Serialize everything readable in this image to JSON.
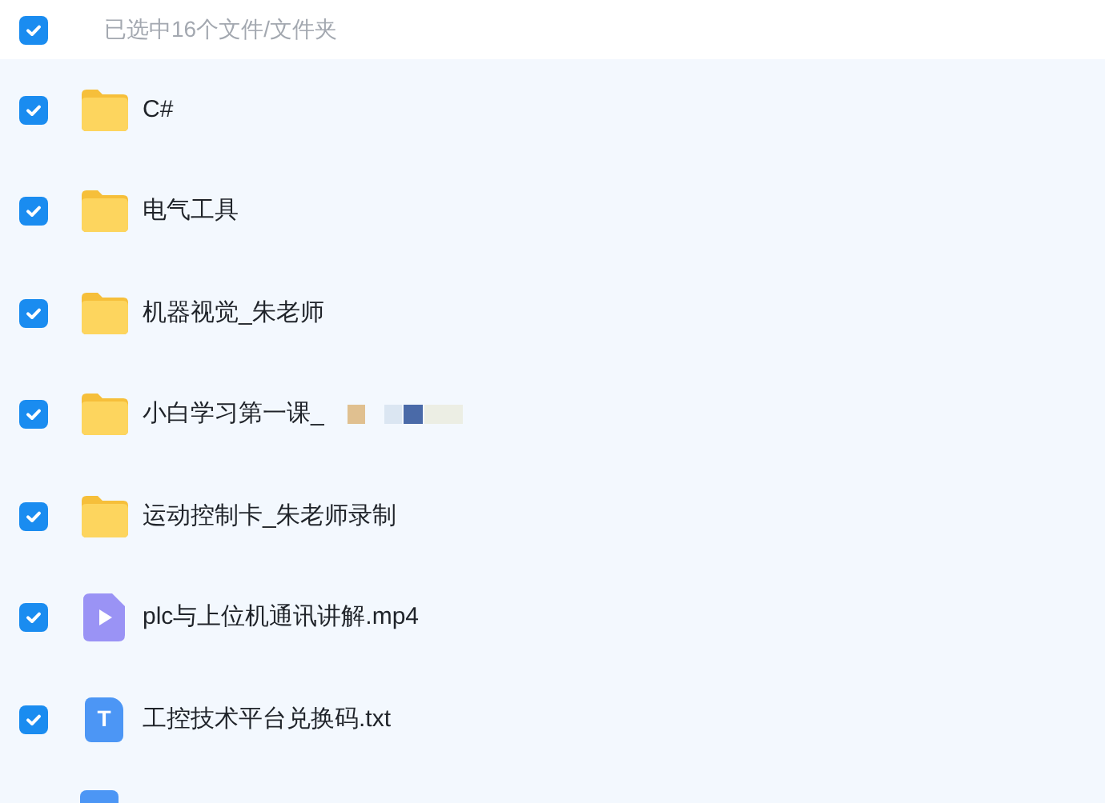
{
  "header": {
    "checked": true,
    "label": "已选中16个文件/文件夹"
  },
  "items": [
    {
      "kind": "folder",
      "name": "C#",
      "checked": true
    },
    {
      "kind": "folder",
      "name": "电气工具",
      "checked": true
    },
    {
      "kind": "folder",
      "name": "机器视觉_朱老师",
      "checked": true
    },
    {
      "kind": "folder",
      "name": "小白学习第一课_",
      "checked": true,
      "redacted": true
    },
    {
      "kind": "folder",
      "name": "运动控制卡_朱老师录制",
      "checked": true
    },
    {
      "kind": "video",
      "name": "plc与上位机通讯讲解.mp4",
      "checked": true
    },
    {
      "kind": "text",
      "name": "工控技术平台兑换码.txt",
      "checked": true,
      "icon_letter": "T"
    }
  ],
  "cut_off_item": {
    "kind": "document"
  }
}
